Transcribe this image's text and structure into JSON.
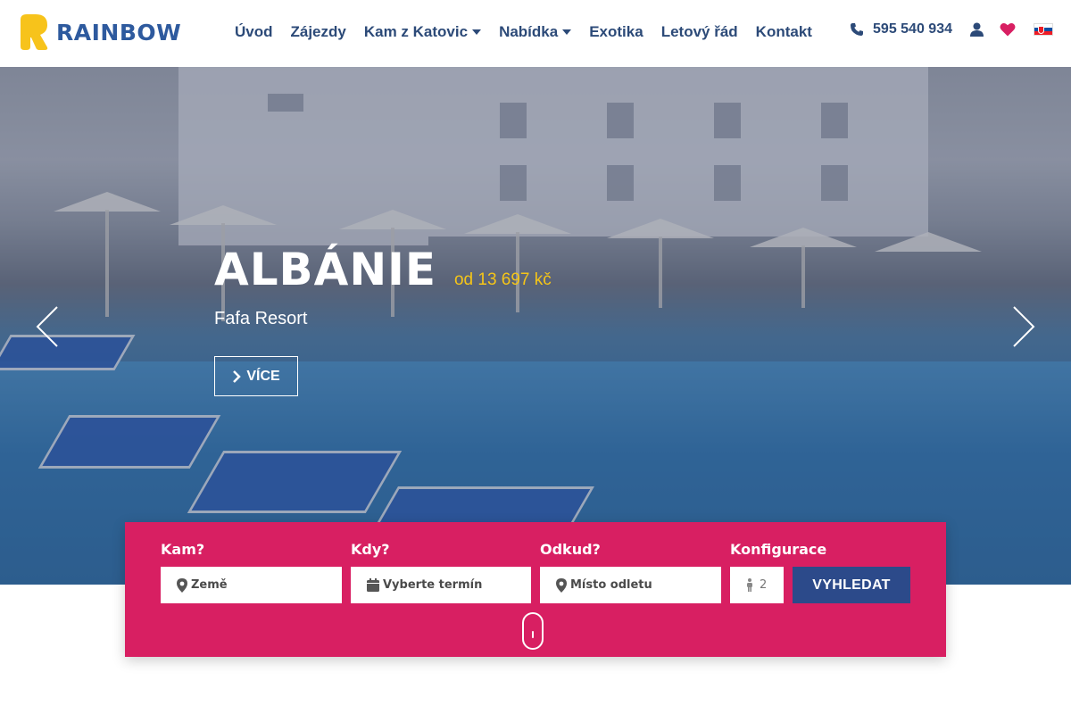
{
  "brand": {
    "name": "RAINBOW",
    "logo_icon": "rainbow-r-logo",
    "color": "#2e5a9e"
  },
  "nav": {
    "items": [
      {
        "label": "Úvod",
        "has_dropdown": false
      },
      {
        "label": "Zájezdy",
        "has_dropdown": false
      },
      {
        "label": "Kam z Katovic",
        "has_dropdown": true
      },
      {
        "label": "Nabídka",
        "has_dropdown": true
      },
      {
        "label": "Exotika",
        "has_dropdown": false
      },
      {
        "label": "Letový řád",
        "has_dropdown": false
      },
      {
        "label": "Kontakt",
        "has_dropdown": false
      }
    ]
  },
  "header": {
    "phone": "595 540 934",
    "phone_icon": "phone-icon",
    "user_icon": "user-icon",
    "favorites_icon": "heart-icon",
    "language_flag": "slovakia-flag"
  },
  "hero": {
    "title": "ALBÁNIE",
    "price": "od 13 697 kč",
    "subtitle": "Fafa Resort",
    "more_label": "VÍCE",
    "prev_icon": "chevron-left-icon",
    "next_icon": "chevron-right-icon"
  },
  "search": {
    "where": {
      "label": "Kam?",
      "placeholder": "Země",
      "icon": "map-marker-icon"
    },
    "when": {
      "label": "Kdy?",
      "placeholder": "Vyberte termín",
      "icon": "calendar-icon"
    },
    "from": {
      "label": "Odkud?",
      "placeholder": "Místo odletu",
      "icon": "map-marker-icon"
    },
    "config": {
      "label": "Konfigurace",
      "value": "2",
      "icon": "person-icon"
    },
    "button_label": "VYHLEDAT"
  },
  "colors": {
    "primary_blue": "#2c4a78",
    "accent_pink": "#d81f62",
    "price_yellow": "#f5c518",
    "search_button": "#2c4a8a"
  }
}
